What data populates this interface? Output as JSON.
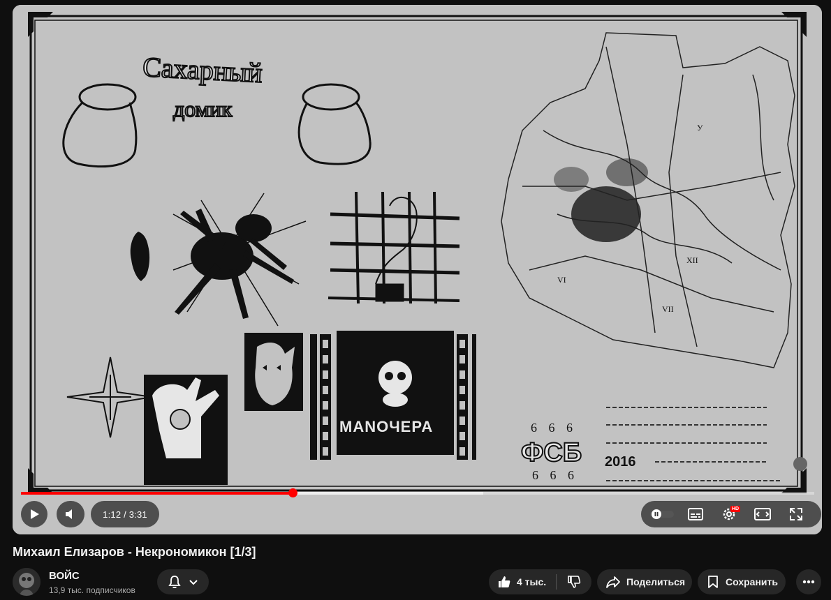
{
  "player": {
    "current_time": "1:12",
    "duration": "3:31",
    "time_display": "1:12 / 3:31",
    "progress": 0.342,
    "buffered": 0.583,
    "hd_badge": "HD",
    "frame": {
      "title_line1": "Сахарный",
      "title_line2": "домик",
      "film_label": "MANOЧEPA",
      "fsb_label": "ФСБ",
      "number_top": "6 6 6",
      "number_bottom": "6 6 6",
      "year_label": "2016"
    }
  },
  "video": {
    "title": "Михаил Елизаров - Некрономикон [1/3]"
  },
  "channel": {
    "name": "ВОЙС",
    "subscribers": "13,9 тыс. подписчиков"
  },
  "actions": {
    "like_count": "4 тыс.",
    "share_label": "Поделиться",
    "save_label": "Сохранить"
  },
  "colors": {
    "progress": "#ff0000",
    "page_bg": "#0f0f0f",
    "button_bg": "#272727"
  }
}
